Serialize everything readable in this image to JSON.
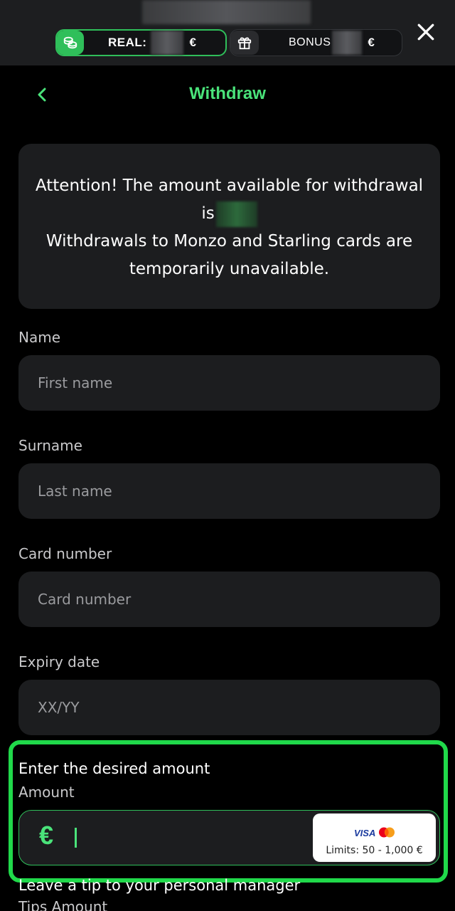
{
  "topbar": {
    "real_label": "REAL:",
    "real_currency": "€",
    "bonus_label": "BONUS",
    "bonus_currency": "€"
  },
  "header": {
    "title": "Withdraw"
  },
  "notice": {
    "line1": "Attention! The amount available for withdrawal is",
    "line2": "Withdrawals to Monzo and Starling cards are temporarily unavailable."
  },
  "form": {
    "name": {
      "label": "Name",
      "placeholder": "First name"
    },
    "surname": {
      "label": "Surname",
      "placeholder": "Last name"
    },
    "card": {
      "label": "Card number",
      "placeholder": "Card number"
    },
    "expiry": {
      "label": "Expiry date",
      "placeholder": "XX/YY"
    },
    "amount": {
      "title": "Enter the desired amount",
      "label": "Amount",
      "currency": "€",
      "card_brand": "VISA",
      "limits": "Limits: 50 - 1,000 €"
    },
    "tip": {
      "title": "Leave a tip to your personal manager",
      "label": "Tips Amount"
    }
  },
  "icons": [
    "coins-icon",
    "gift-icon",
    "close-icon",
    "chevron-left-icon",
    "mastercard-icon"
  ],
  "colors": {
    "accent": "#4ae37a",
    "highlight": "#20d94a",
    "panel": "#1c1d1f"
  }
}
